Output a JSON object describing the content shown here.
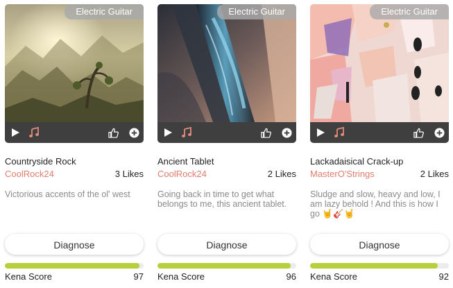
{
  "cards": [
    {
      "genre": "Electric Guitar",
      "title": "Countryside Rock",
      "author": "CoolRock24",
      "likes": "3 Likes",
      "description": "Victorious accents of the ol' west",
      "diagnose_label": "Diagnose",
      "score_label": "Kena Score",
      "score": "97",
      "score_fraction": 0.97
    },
    {
      "genre": "Electric Guitar",
      "title": "Ancient Tablet",
      "author": "CoolRock24",
      "likes": "2 Likes",
      "description": "Going back in time to get what belongs to me, this ancient tablet.",
      "diagnose_label": "Diagnose",
      "score_label": "Kena Score",
      "score": "96",
      "score_fraction": 0.96
    },
    {
      "genre": "Electric Guitar",
      "title": "Lackadaisical Crack-up",
      "author": "MasterO'Strings",
      "likes": "2 Likes",
      "description": "Sludge and slow, heavy and low, I am lazy behold ! And this is how I go 🤘🎸🤘",
      "diagnose_label": "Diagnose",
      "score_label": "Kena Score",
      "score": "92",
      "score_fraction": 0.92
    }
  ],
  "icons": {
    "play": "play-icon",
    "note": "music-note-icon",
    "like": "thumbs-up-icon",
    "add": "add-icon"
  },
  "colors": {
    "author": "#e07d6c",
    "note_icon": "#e48a7c",
    "control_bar": "#3f3f3f",
    "score_fill": "#b8cf3c",
    "score_track": "#ececec",
    "genre_badge": "#aaaaaa"
  }
}
